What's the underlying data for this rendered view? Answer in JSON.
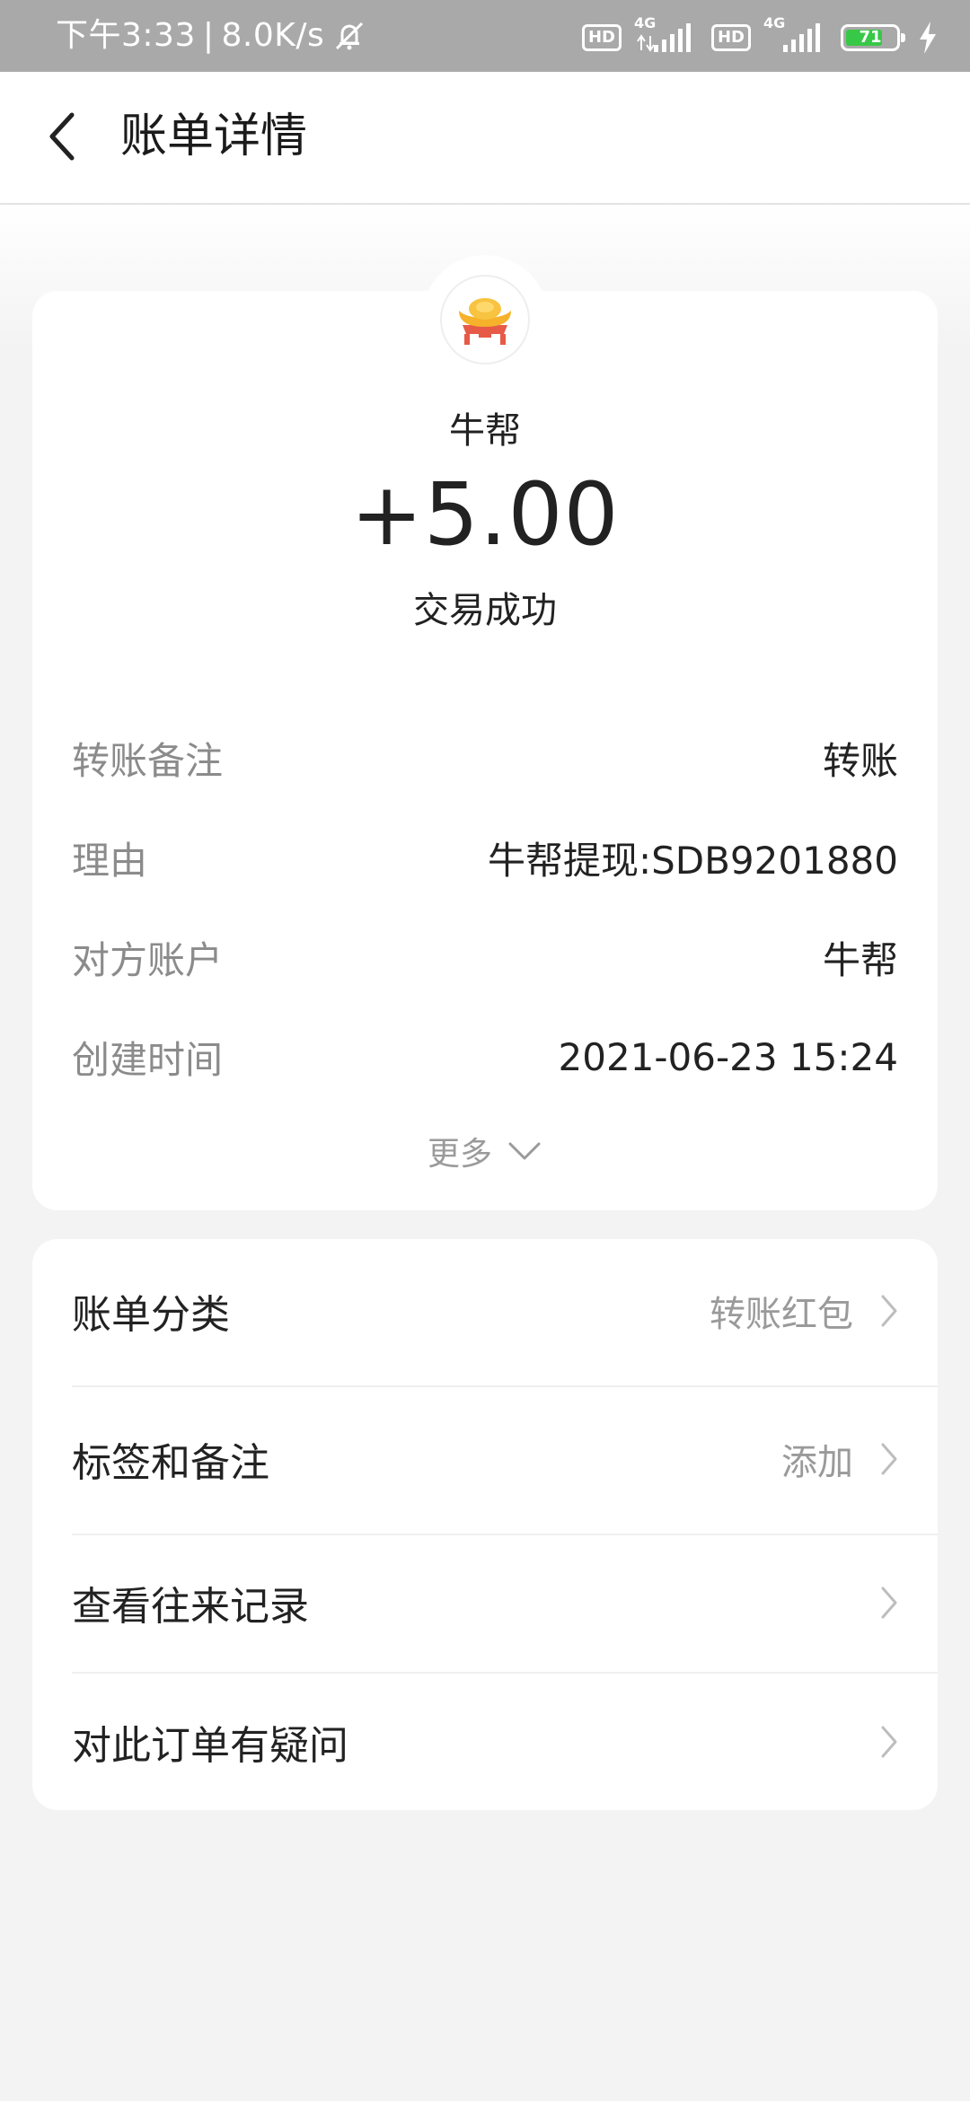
{
  "status_bar": {
    "time": "下午3:33",
    "net_speed": "8.0K/s",
    "hd1": "HD",
    "lte1": "4G",
    "hd2": "HD",
    "lte2": "4G",
    "battery_level": "71"
  },
  "header": {
    "title": "账单详情"
  },
  "transaction": {
    "payee": "牛帮",
    "amount": "+5.00",
    "status": "交易成功",
    "details": [
      {
        "key": "转账备注",
        "value": "转账"
      },
      {
        "key": "理由",
        "value": "牛帮提现:SDB9201880"
      },
      {
        "key": "对方账户",
        "value": "牛帮"
      },
      {
        "key": "创建时间",
        "value": "2021-06-23 15:24"
      }
    ],
    "more_label": "更多"
  },
  "menu": [
    {
      "label": "账单分类",
      "value": "转账红包"
    },
    {
      "label": "标签和备注",
      "value": "添加"
    },
    {
      "label": "查看往来记录",
      "value": ""
    },
    {
      "label": "对此订单有疑问",
      "value": ""
    }
  ],
  "colors": {
    "statusbar_bg": "#a9a9a9",
    "battery_green": "#38c847",
    "gold": "#f5b22a",
    "red_stand": "#e65a47"
  },
  "icons": {
    "back": "chevron-left-icon",
    "more": "chevron-down-icon",
    "row_arrow": "chevron-right-icon",
    "avatar": "gold-ingot-icon"
  }
}
